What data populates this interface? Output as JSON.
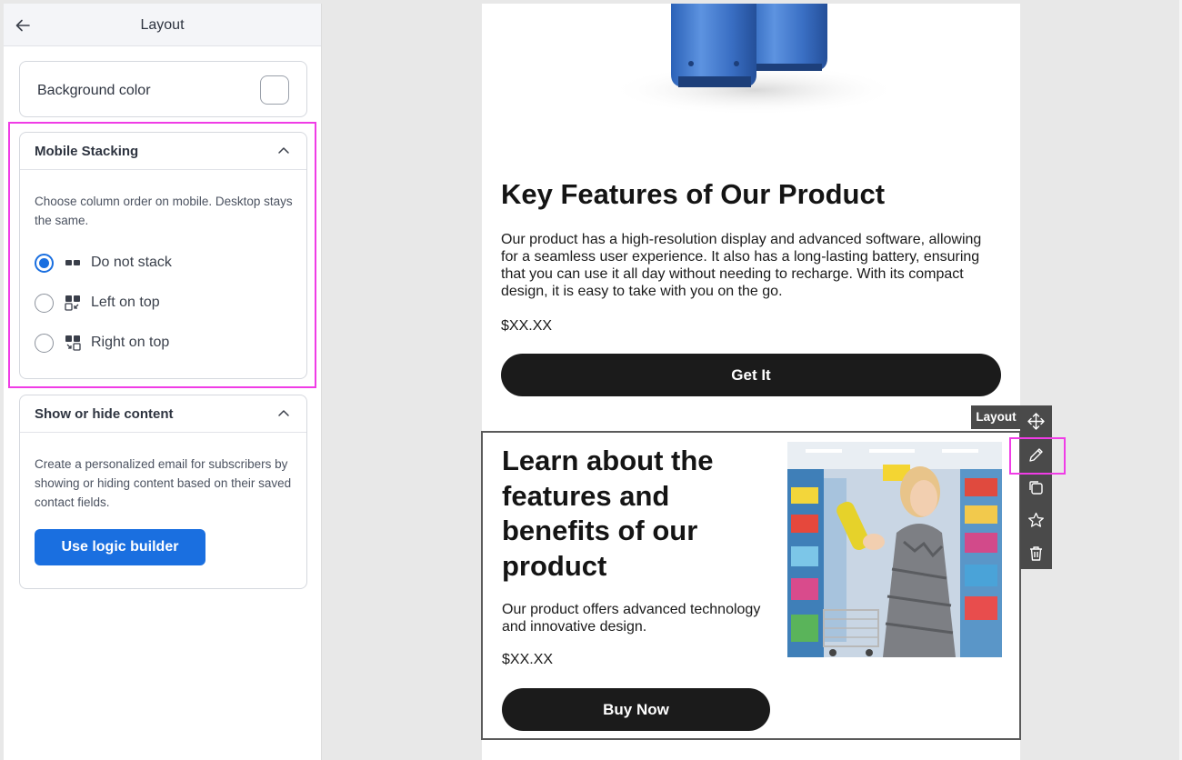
{
  "panel": {
    "title": "Layout",
    "background_color": {
      "label": "Background color",
      "value": "#ffffff"
    },
    "mobile_stacking": {
      "title": "Mobile Stacking",
      "description": "Choose column order on mobile. Desktop stays the same.",
      "options": [
        {
          "label": "Do not stack",
          "selected": true,
          "icon": "columns-side-by-side-icon"
        },
        {
          "label": "Left on top",
          "selected": false,
          "icon": "left-on-top-icon"
        },
        {
          "label": "Right on top",
          "selected": false,
          "icon": "right-on-top-icon"
        }
      ]
    },
    "show_hide": {
      "title": "Show or hide content",
      "description": "Create a personalized email for subscribers by showing or hiding content based on their saved contact fields.",
      "button_label": "Use logic builder"
    }
  },
  "email": {
    "block1": {
      "heading": "Key Features of Our Product",
      "body": "Our product has a high-resolution display and advanced software, allowing for a seamless user experience. It also has a long-lasting battery, ensuring that you can use it all day without needing to recharge. With its compact design, it is easy to take with you on the go.",
      "price": "$XX.XX",
      "button_label": "Get It"
    },
    "block2": {
      "heading": "Learn about the features and benefits of our product",
      "body": "Our product offers advanced technology and innovative design.",
      "price": "$XX.XX",
      "button_label": "Buy Now"
    }
  },
  "toolbar": {
    "label": "Layout",
    "buttons": [
      "move-icon",
      "edit-icon",
      "duplicate-icon",
      "star-icon",
      "trash-icon"
    ]
  },
  "colors": {
    "accent": "#1a6fe0",
    "highlight": "#f03ce6",
    "dark_button": "#1b1b1b"
  }
}
